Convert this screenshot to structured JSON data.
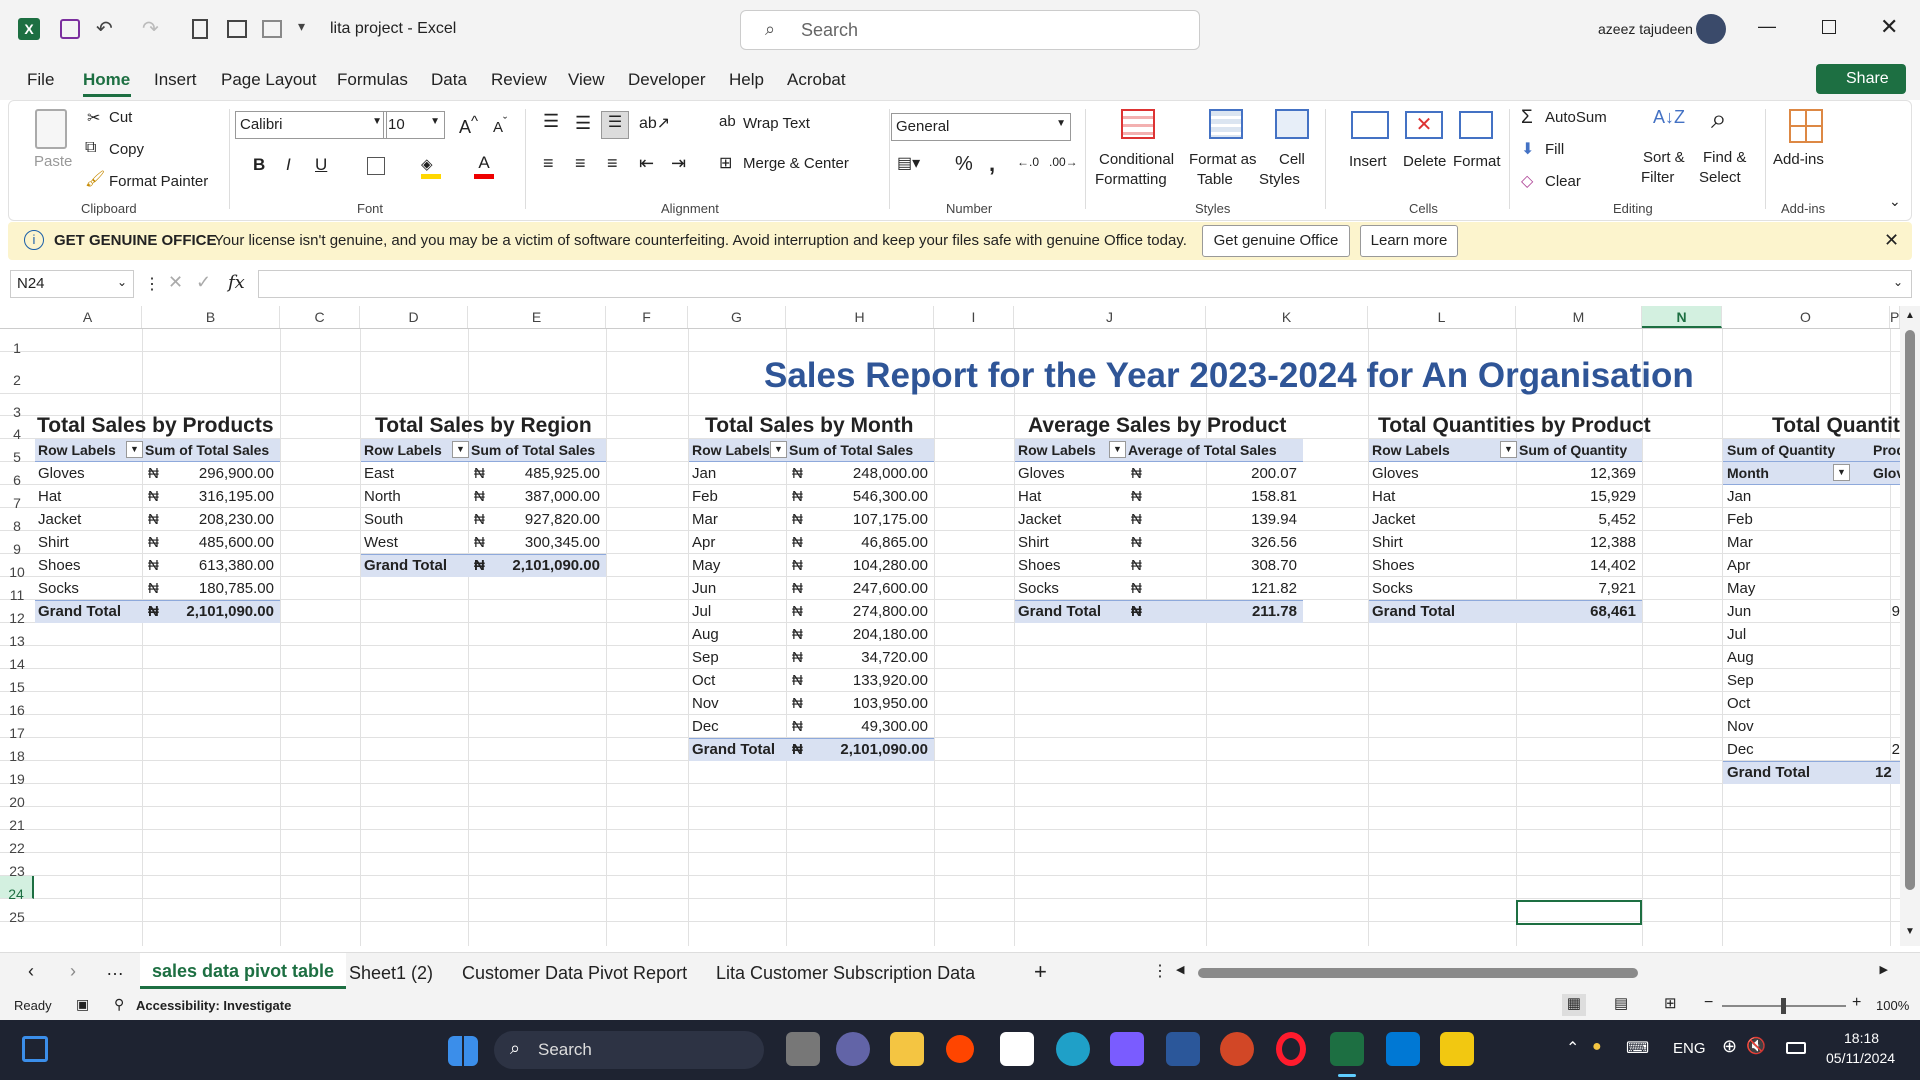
{
  "window": {
    "title": "lita project  -  Excel",
    "search_placeholder": "Search",
    "user": "azeez tajudeen"
  },
  "menu": [
    "File",
    "Home",
    "Insert",
    "Page Layout",
    "Formulas",
    "Data",
    "Review",
    "View",
    "Developer",
    "Help",
    "Acrobat"
  ],
  "share_label": "Share",
  "ribbon": {
    "clipboard": {
      "paste": "Paste",
      "cut": "Cut",
      "copy": "Copy",
      "format_painter": "Format Painter",
      "group": "Clipboard"
    },
    "font": {
      "name": "Calibri",
      "size": "10",
      "bold": "B",
      "italic": "I",
      "underline": "U",
      "group": "Font"
    },
    "alignment": {
      "wrap": "Wrap Text",
      "merge": "Merge & Center",
      "group": "Alignment"
    },
    "number": {
      "format": "General",
      "group": "Number"
    },
    "styles": {
      "conditional": "Conditional",
      "conditional2": "Formatting",
      "format_table": "Format as",
      "format_table2": "Table",
      "cell_styles": "Cell",
      "cell_styles2": "Styles",
      "group": "Styles"
    },
    "cells": {
      "insert": "Insert",
      "delete": "Delete",
      "format": "Format",
      "group": "Cells"
    },
    "editing": {
      "autosum": "AutoSum",
      "fill": "Fill",
      "clear": "Clear",
      "sort": "Sort &",
      "sort2": "Filter",
      "find": "Find &",
      "find2": "Select",
      "group": "Editing"
    },
    "addins": {
      "label": "Add-ins",
      "group": "Add-ins"
    }
  },
  "banner": {
    "title": "GET GENUINE OFFICE",
    "message": "Your license isn't genuine, and you may be a victim of software counterfeiting. Avoid interruption and keep your files safe with genuine Office today.",
    "btn1": "Get genuine Office",
    "btn2": "Learn more"
  },
  "formula": {
    "namebox": "N24",
    "fx": "fx",
    "value": ""
  },
  "columns": [
    "A",
    "B",
    "C",
    "D",
    "E",
    "F",
    "G",
    "H",
    "I",
    "J",
    "K",
    "L",
    "M",
    "N",
    "O",
    "P",
    "C"
  ],
  "rows": [
    "1",
    "2",
    "3",
    "4",
    "5",
    "6",
    "7",
    "8",
    "9",
    "10",
    "11",
    "12",
    "13",
    "14",
    "15",
    "16",
    "17",
    "18",
    "19",
    "20",
    "21",
    "22",
    "23",
    "24",
    "25"
  ],
  "report_title": "Sales Report for the Year 2023-2024 for An Organisation",
  "currency": "₦",
  "pivots": {
    "products": {
      "title": "Total Sales by Products",
      "h1": "Row Labels",
      "h2": "Sum of Total Sales",
      "rows": [
        [
          "Gloves",
          "296,900.00"
        ],
        [
          "Hat",
          "316,195.00"
        ],
        [
          "Jacket",
          "208,230.00"
        ],
        [
          "Shirt",
          "485,600.00"
        ],
        [
          "Shoes",
          "613,380.00"
        ],
        [
          "Socks",
          "180,785.00"
        ]
      ],
      "total_label": "Grand Total",
      "total": "2,101,090.00"
    },
    "region": {
      "title": "Total Sales by Region",
      "h1": "Row Labels",
      "h2": "Sum of Total Sales",
      "rows": [
        [
          "East",
          "485,925.00"
        ],
        [
          "North",
          "387,000.00"
        ],
        [
          "South",
          "927,820.00"
        ],
        [
          "West",
          "300,345.00"
        ]
      ],
      "total_label": "Grand Total",
      "total": "2,101,090.00"
    },
    "month": {
      "title": "Total Sales by Month",
      "h1": "Row Labels",
      "h2": "Sum of Total Sales",
      "rows": [
        [
          "Jan",
          "248,000.00"
        ],
        [
          "Feb",
          "546,300.00"
        ],
        [
          "Mar",
          "107,175.00"
        ],
        [
          "Apr",
          "46,865.00"
        ],
        [
          "May",
          "104,280.00"
        ],
        [
          "Jun",
          "247,600.00"
        ],
        [
          "Jul",
          "274,800.00"
        ],
        [
          "Aug",
          "204,180.00"
        ],
        [
          "Sep",
          "34,720.00"
        ],
        [
          "Oct",
          "133,920.00"
        ],
        [
          "Nov",
          "103,950.00"
        ],
        [
          "Dec",
          "49,300.00"
        ]
      ],
      "total_label": "Grand Total",
      "total": "2,101,090.00"
    },
    "average": {
      "title": "Average Sales by Product",
      "h1": "Row Labels",
      "h2": "Average of Total Sales",
      "rows": [
        [
          "Gloves",
          "200.07"
        ],
        [
          "Hat",
          "158.81"
        ],
        [
          "Jacket",
          "139.94"
        ],
        [
          "Shirt",
          "326.56"
        ],
        [
          "Shoes",
          "308.70"
        ],
        [
          "Socks",
          "121.82"
        ]
      ],
      "total_label": "Grand Total",
      "total": "211.78"
    },
    "quantity": {
      "title": "Total Quantities by Product",
      "h1": "Row Labels",
      "h2": "Sum of Quantity",
      "rows": [
        [
          "Gloves",
          "12,369"
        ],
        [
          "Hat",
          "15,929"
        ],
        [
          "Jacket",
          "5,452"
        ],
        [
          "Shirt",
          "12,388"
        ],
        [
          "Shoes",
          "14,402"
        ],
        [
          "Socks",
          "7,921"
        ]
      ],
      "total_label": "Grand Total",
      "total": "68,461"
    },
    "qmonth": {
      "title": "Total Quantit",
      "h1": "Sum of Quantity",
      "h2": "Produ",
      "h3": "Month",
      "h4": "Glove",
      "rows": [
        "Jan",
        "Feb",
        "Mar",
        "Apr",
        "May",
        "Jun",
        "Jul",
        "Aug",
        "Sep",
        "Oct",
        "Nov",
        "Dec"
      ],
      "partial": {
        "Jun": "9",
        "Dec": "2"
      },
      "total_label": "Grand Total",
      "total": "12"
    }
  },
  "sheets": [
    "sales data pivot table",
    "Sheet1 (2)",
    "Customer Data Pivot Report",
    "Lita Customer Subscription Data"
  ],
  "status": {
    "ready": "Ready",
    "accessibility": "Accessibility: Investigate",
    "zoom": "100%"
  },
  "taskbar": {
    "search": "Search",
    "lang": "ENG",
    "time": "18:18",
    "date": "05/11/2024"
  }
}
